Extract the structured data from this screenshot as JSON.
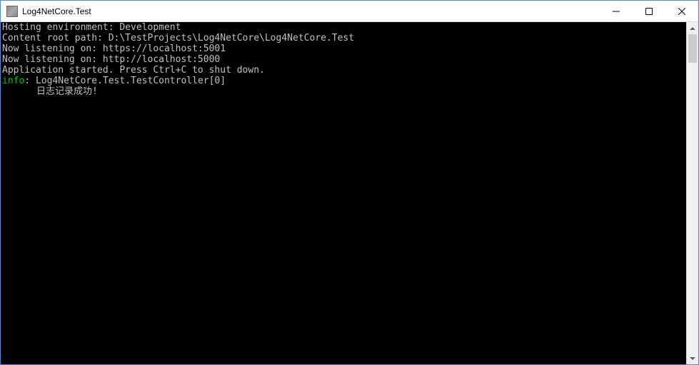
{
  "window": {
    "title": "Log4NetCore.Test"
  },
  "controls": {
    "minimize": "minimize",
    "maximize": "maximize",
    "close": "close"
  },
  "console": {
    "lines": [
      "Hosting environment: Development",
      "Content root path: D:\\TestProjects\\Log4NetCore\\Log4NetCore.Test",
      "Now listening on: https://localhost:5001",
      "Now listening on: http://localhost:5000",
      "Application started. Press Ctrl+C to shut down."
    ],
    "info_label": "info",
    "info_suffix": ": Log4NetCore.Test.TestController[0]",
    "info_message": "日志记录成功!"
  }
}
